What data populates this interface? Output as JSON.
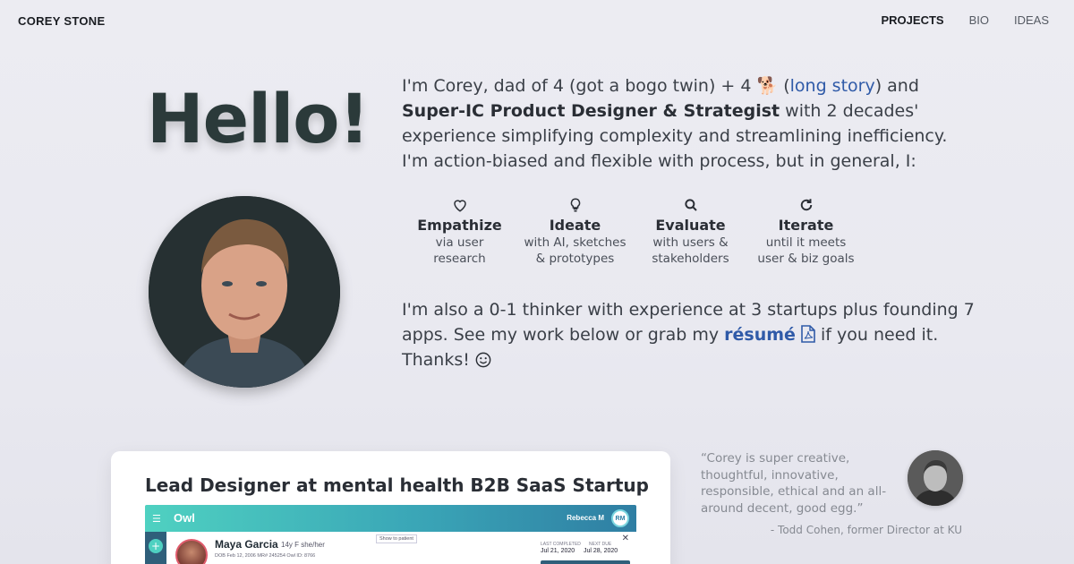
{
  "site": {
    "name": "COREY STONE"
  },
  "nav": {
    "items": [
      {
        "label": "PROJECTS",
        "active": true
      },
      {
        "label": "BIO",
        "active": false
      },
      {
        "label": "IDEAS",
        "active": false
      }
    ]
  },
  "hero": {
    "greeting": "Hello!",
    "avatar_icon": "portrait-photo",
    "intro": {
      "p1": "I'm Corey, dad of 4 (got a bogo twin) + 4 ",
      "dog": "🐕",
      "p2": " (",
      "link": "long story",
      "p3": ") and ",
      "bold": "Super-IC Product Designer & Strategist",
      "p4": " with 2 decades' experience simplifying complexity and streamlining inefficiency. I'm action-biased and flexible with process, but in general, I:"
    },
    "steps": [
      {
        "icon": "heart-icon",
        "title": "Empathize",
        "line1": "via user",
        "line2": "research"
      },
      {
        "icon": "lightbulb-icon",
        "title": "Ideate",
        "line1": "with AI, sketches",
        "line2": "& prototypes"
      },
      {
        "icon": "search-icon",
        "title": "Evaluate",
        "line1": "with users &",
        "line2": "stakeholders"
      },
      {
        "icon": "redo-icon",
        "title": "Iterate",
        "line1": "until it meets",
        "line2": "user & biz goals"
      }
    ],
    "outro": {
      "p1": "I'm also a 0-1 thinker with experience at 3 startups plus founding 7 apps. See my work below or grab my ",
      "resume": "résumé",
      "p2": " if you need it. Thanks! "
    }
  },
  "project": {
    "title": "Lead Designer at mental health B2B SaaS Startup",
    "mock": {
      "brand": "Owl",
      "user": "Rebecca M",
      "initials": "RM",
      "patient_name": "Maya Garcia",
      "patient_meta": "14y F she/her",
      "patient_info": "DOB Feb 12, 2006   MR# 245254   Owl ID: 8766",
      "show_label": "Show to patient",
      "last_completed_label": "LAST COMPLETED",
      "last_completed": "Jul 21, 2020",
      "next_due_label": "NEXT DUE",
      "next_due": "Jul 28, 2020"
    }
  },
  "testimonial": {
    "quote": "“Corey is super creative, thoughtful, innovative, responsible, ethical and an all-around decent, good egg.”",
    "attribution": "- Todd Cohen, former Director at KU"
  },
  "colors": {
    "link": "#2f5aa8",
    "heading": "#2b3a3a",
    "accent": "#4fd1c1"
  }
}
